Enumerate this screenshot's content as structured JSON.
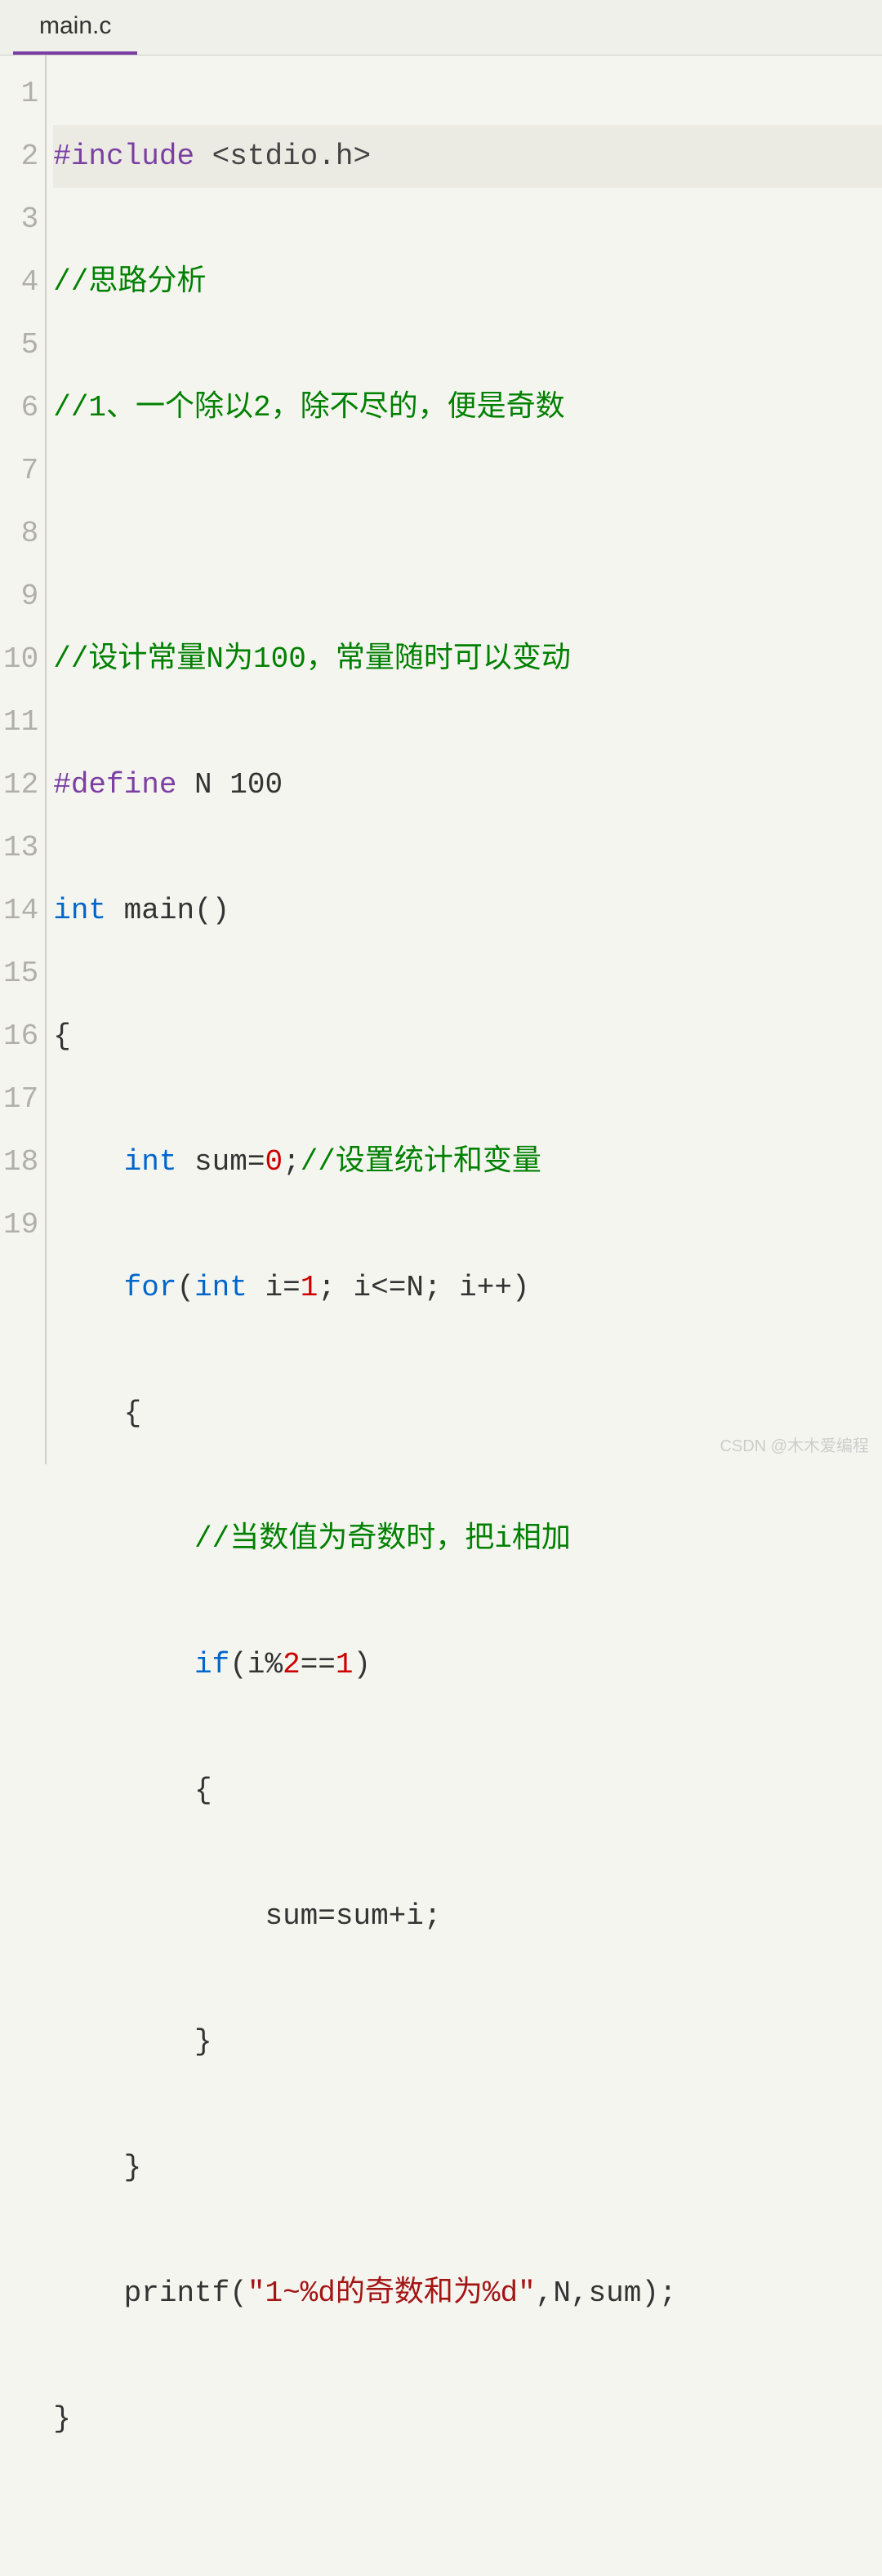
{
  "tab": {
    "filename": "main.c"
  },
  "gutter": [
    "1",
    "2",
    "3",
    "4",
    "5",
    "6",
    "7",
    "8",
    "9",
    "10",
    "11",
    "12",
    "13",
    "14",
    "15",
    "16",
    "17",
    "18",
    "19"
  ],
  "code": {
    "l1": {
      "pp": "#include",
      "inc": " <stdio.h>"
    },
    "l2": {
      "com": "//思路分析"
    },
    "l3": {
      "com": "//1、一个除以2，除不尽的，便是奇数"
    },
    "l4": {
      "blank": ""
    },
    "l5": {
      "com": "//设计常量N为100，常量随时可以变动"
    },
    "l6": {
      "pp": "#define",
      "rest": " N 100"
    },
    "l7": {
      "type": "int",
      "rest": " main()"
    },
    "l8": {
      "text": "{"
    },
    "l9": {
      "indent": "    ",
      "type": "int",
      "mid": " sum=",
      "num": "0",
      "semi": ";",
      "com": "//设置统计和变量"
    },
    "l10": {
      "indent": "    ",
      "kw": "for",
      "p1": "(",
      "type": "int",
      "mid1": " i=",
      "num1": "1",
      "mid2": "; i<=N; i++)"
    },
    "l11": {
      "text": "    {"
    },
    "l12": {
      "indent": "        ",
      "com": "//当数值为奇数时，把i相加"
    },
    "l13": {
      "indent": "        ",
      "kw": "if",
      "p1": "(i%",
      "num1": "2",
      "p2": "==",
      "num2": "1",
      "p3": ")"
    },
    "l14": {
      "text": "        {"
    },
    "l15": {
      "text": "            sum=sum+i;"
    },
    "l16": {
      "text": "        }"
    },
    "l17": {
      "text": "    }"
    },
    "l18": {
      "indent": "    ",
      "fn": "printf(",
      "str": "\"1~%d的奇数和为%d\"",
      "rest": ",N,sum);"
    },
    "l19": {
      "text": "}"
    }
  },
  "watermark": "CSDN @木木爱编程"
}
